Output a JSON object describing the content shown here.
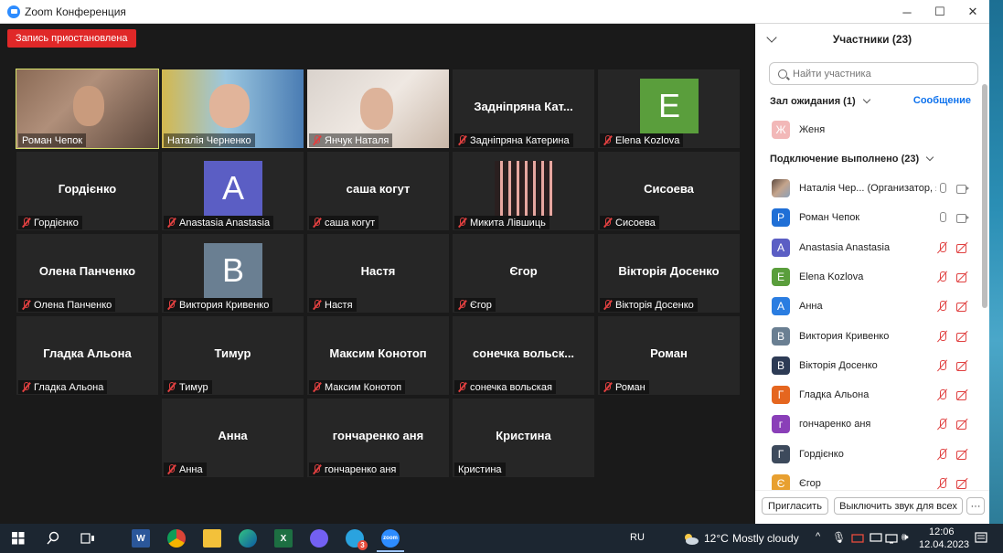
{
  "window": {
    "title": "Zoom Конференция"
  },
  "recording": {
    "badge": "Запись приостановлена"
  },
  "tiles": [
    {
      "kind": "video",
      "variant": 1,
      "active": true,
      "label": "Роман Чепок",
      "muted": false
    },
    {
      "kind": "video",
      "variant": 2,
      "active": false,
      "label": "Наталія Черненко",
      "muted": false
    },
    {
      "kind": "video",
      "variant": 3,
      "active": false,
      "label": "Янчук Наталя",
      "muted": true
    },
    {
      "kind": "name",
      "center": "Задніпряна Кат...",
      "label": "Задніпряна Катерина",
      "muted": true
    },
    {
      "kind": "avatar",
      "letter": "E",
      "color": "#5a9e3c",
      "label": "Elena Kozlova",
      "muted": true
    },
    {
      "kind": "name",
      "center": "Гордієнко",
      "label": "Гордієнко",
      "muted": true
    },
    {
      "kind": "avatar",
      "letter": "A",
      "color": "#5b5ec4",
      "label": "Anastasia Anastasia",
      "muted": true
    },
    {
      "kind": "name",
      "center": "саша когут",
      "label": "саша когут",
      "muted": true
    },
    {
      "kind": "photo",
      "label": "Микита Лівшиць",
      "muted": true
    },
    {
      "kind": "name",
      "center": "Сисоева",
      "label": "Сисоева",
      "muted": true
    },
    {
      "kind": "name",
      "center": "Олена Панченко",
      "label": "Олена Панченко",
      "muted": true
    },
    {
      "kind": "avatar",
      "letter": "B",
      "color": "#6a7f92",
      "label": "Виктория Кривенко",
      "muted": true
    },
    {
      "kind": "name",
      "center": "Настя",
      "label": "Настя",
      "muted": true
    },
    {
      "kind": "name",
      "center": "Єгор",
      "label": "Єгор",
      "muted": true
    },
    {
      "kind": "name",
      "center": "Вікторія Досенко",
      "label": "Вікторія Досенко",
      "muted": true
    },
    {
      "kind": "name",
      "center": "Гладка Альона",
      "label": "Гладка Альона",
      "muted": true
    },
    {
      "kind": "name",
      "center": "Тимур",
      "label": "Тимур",
      "muted": true
    },
    {
      "kind": "name",
      "center": "Максим Конотоп",
      "label": "Максим Конотоп",
      "muted": true
    },
    {
      "kind": "name",
      "center": "сонечка  вольск...",
      "label": "сонечка вольская",
      "muted": true
    },
    {
      "kind": "name",
      "center": "Роман",
      "label": "Роман",
      "muted": true
    },
    {
      "kind": "name",
      "center": "Анна",
      "label": "Анна",
      "muted": true
    },
    {
      "kind": "name",
      "center": "гончаренко аня",
      "label": "гончаренко аня",
      "muted": true
    },
    {
      "kind": "name",
      "center": "Кристина",
      "label": "Кристина",
      "muted": false
    }
  ],
  "panel": {
    "title": "Участники (23)",
    "search_placeholder": "Найти участника",
    "waiting_title": "Зал ожидания (1)",
    "message_link": "Сообщение",
    "waiting": [
      {
        "letter": "Ж",
        "color": "#f2b8b8",
        "name": "Женя"
      }
    ],
    "joined_title": "Подключение выполнено (23)",
    "participants": [
      {
        "letter": "",
        "color": "#8a7a70",
        "name": "Наталія Чер...  (Организатор, я)",
        "audio": "on",
        "photo": true
      },
      {
        "letter": "Р",
        "color": "#1f6fd6",
        "name": "Роман Чепок",
        "audio": "on"
      },
      {
        "letter": "A",
        "color": "#5b5ec4",
        "name": "Anastasia Anastasia",
        "audio": "off"
      },
      {
        "letter": "E",
        "color": "#5a9e3c",
        "name": "Elena Kozlova",
        "audio": "off"
      },
      {
        "letter": "А",
        "color": "#2a7de1",
        "name": "Анна",
        "audio": "off"
      },
      {
        "letter": "В",
        "color": "#6a7f92",
        "name": "Виктория Кривенко",
        "audio": "off"
      },
      {
        "letter": "В",
        "color": "#2d3b55",
        "name": "Вікторія Досенко",
        "audio": "off"
      },
      {
        "letter": "Г",
        "color": "#e5661f",
        "name": "Гладка Альона",
        "audio": "off"
      },
      {
        "letter": "г",
        "color": "#8a3fb8",
        "name": "гончаренко аня",
        "audio": "off"
      },
      {
        "letter": "Г",
        "color": "#3d4a5c",
        "name": "Гордієнко",
        "audio": "off"
      },
      {
        "letter": "Є",
        "color": "#e8a030",
        "name": "Єгор",
        "audio": "off"
      }
    ],
    "invite_label": "Пригласить",
    "mute_all_label": "Выключить звук для всех",
    "more_label": "···"
  },
  "taskbar": {
    "language": "RU",
    "temperature": "12°C",
    "weather": "Mostly cloudy",
    "time": "12:06",
    "date": "12.04.2023",
    "telegram_badge": "3",
    "zoom_label": "zoom"
  }
}
